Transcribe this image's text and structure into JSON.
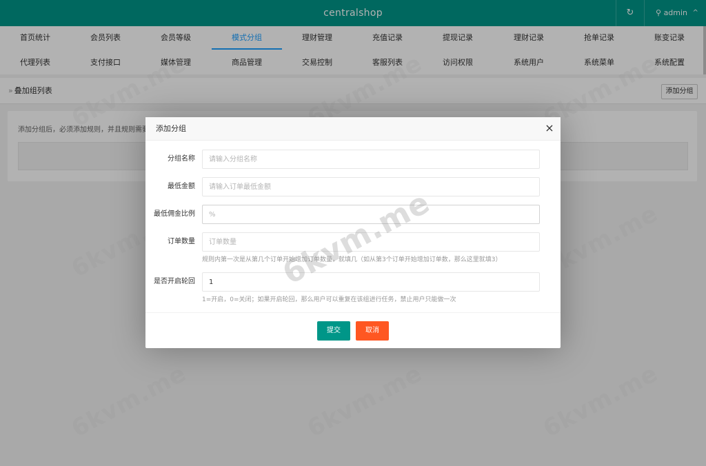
{
  "header": {
    "brand": "centralshop",
    "refresh_icon": "↻",
    "user_label": "admin",
    "user_icon": "⚲",
    "caret_icon": "^"
  },
  "nav": {
    "active": "模式分组",
    "row1": [
      "首页统计",
      "会员列表",
      "会员等级",
      "模式分组",
      "理财管理",
      "充值记录",
      "提现记录",
      "理财记录",
      "抢单记录",
      "账变记录"
    ],
    "row2": [
      "代理列表",
      "支付接口",
      "媒体管理",
      "商品管理",
      "交易控制",
      "客服列表",
      "访问权限",
      "系统用户",
      "系统菜单",
      "系统配置"
    ]
  },
  "breadcrumb": {
    "arrow": "»",
    "title": "叠加组列表",
    "add_button": "添加分组"
  },
  "card": {
    "note": "添加分组后，必须添加规则，并且规则需要对应"
  },
  "modal": {
    "title": "添加分组",
    "close": "×",
    "fields": [
      {
        "label": "分组名称",
        "placeholder": "请输入分组名称",
        "value": "",
        "hint": ""
      },
      {
        "label": "最低金额",
        "placeholder": "请输入订单最低金额",
        "value": "",
        "hint": ""
      },
      {
        "label": "最低佣金比例",
        "placeholder": "%",
        "value": "",
        "hint": ""
      },
      {
        "label": "订单数量",
        "placeholder": "订单数量",
        "value": "",
        "hint": "规则内第一次是从第几个订单开始增加订单数量，就填几（如从第3个订单开始增加订单数，那么这里就填3）"
      },
      {
        "label": "是否开启轮回",
        "placeholder": "",
        "value": "1",
        "hint": "1=开启，0=关闭；如果开启轮回，那么用户可以重复在该组进行任务，禁止用户只能做一次"
      }
    ],
    "submit": "提交",
    "cancel": "取消"
  },
  "watermark": "6kvm.me"
}
